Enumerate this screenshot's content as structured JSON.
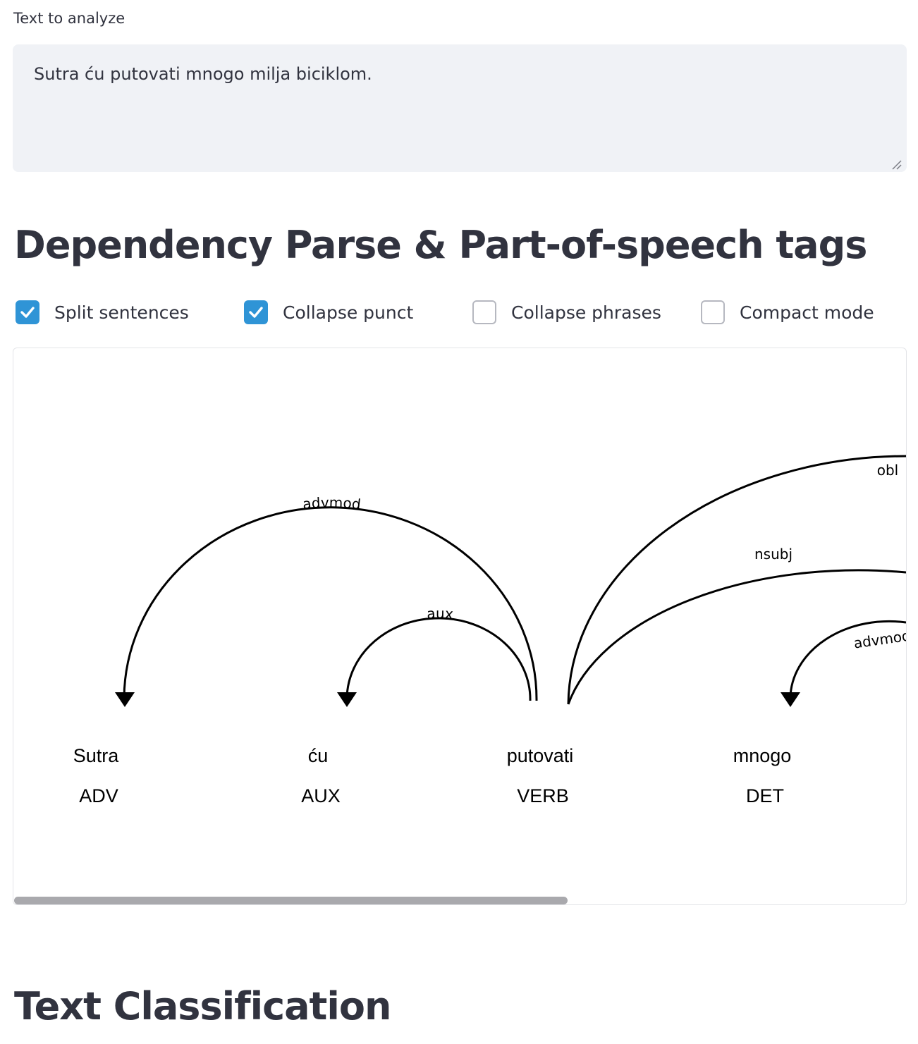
{
  "input": {
    "label": "Text to analyze",
    "value": "Sutra ću putovati mnogo milja biciklom."
  },
  "dependency": {
    "title": "Dependency Parse & Part-of-speech tags",
    "options": [
      {
        "label": "Split sentences",
        "checked": true
      },
      {
        "label": "Collapse punct",
        "checked": true
      },
      {
        "label": "Collapse phrases",
        "checked": false
      },
      {
        "label": "Compact mode",
        "checked": false
      }
    ],
    "tokens": [
      {
        "text": "Sutra",
        "tag": "ADV"
      },
      {
        "text": "ću",
        "tag": "AUX"
      },
      {
        "text": "putovati",
        "tag": "VERB"
      },
      {
        "text": "mnogo",
        "tag": "DET"
      }
    ],
    "arcs": [
      {
        "label": "advmod"
      },
      {
        "label": "aux"
      },
      {
        "label": "obl"
      },
      {
        "label": "nsubj"
      },
      {
        "label": "advmod"
      }
    ]
  },
  "classification": {
    "title": "Text Classification"
  },
  "colors": {
    "accent": "#2f94d6",
    "input_bg": "#f0f2f6",
    "text": "#31333f"
  }
}
